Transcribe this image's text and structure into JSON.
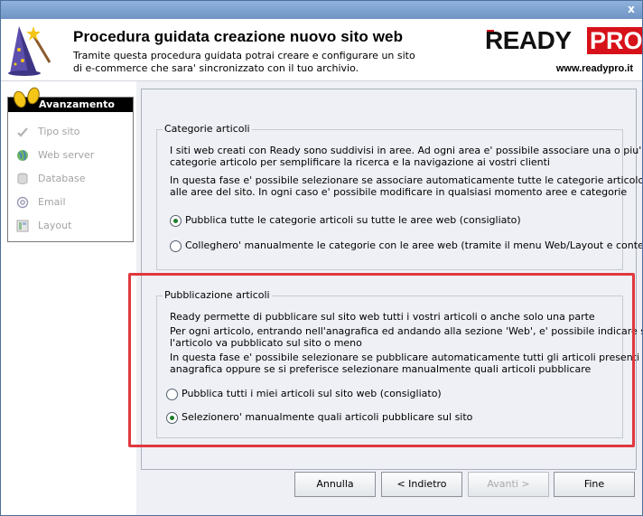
{
  "window": {
    "close_glyph": "x"
  },
  "header": {
    "title": "Procedura guidata creazione nuovo sito web",
    "description": "Tramite questa procedura guidata potrai creare e configurare un sito di e-commerce che sara' sincronizzato con il tuo archivio.",
    "logo": {
      "ready": "READY",
      "pro": "PRO",
      "brand_color": "#d7111a"
    },
    "url": "www.readypro.it"
  },
  "sidebar": {
    "title": "Avanzamento",
    "steps": [
      {
        "label": "Tipo sito",
        "icon": "checkmark-icon"
      },
      {
        "label": "Web server",
        "icon": "globe-icon"
      },
      {
        "label": "Database",
        "icon": "database-icon"
      },
      {
        "label": "Email",
        "icon": "at-sign-icon"
      },
      {
        "label": "Layout",
        "icon": "layout-icon"
      }
    ]
  },
  "categorie": {
    "legend": "Categorie articoli",
    "line1": "I siti web creati con Ready sono suddivisi in aree. Ad ogni area e' possibile associare una o piu'",
    "line2": "categorie articolo per semplificare la ricerca e la navigazione ai vostri clienti",
    "line3": "In questa fase e' possibile selezionare se associare automaticamente tutte le categorie articolo",
    "line4": "alle aree del sito. In ogni caso e' possibile modificare in qualsiasi momento aree e categorie",
    "option1": "Pubblica tutte le categorie articoli su tutte le aree web (consigliato)",
    "option2": "Colleghero' manualmente le categorie con le aree web (tramite il menu Web/Layout e contenuti)",
    "selected": 1
  },
  "pubblicazione": {
    "legend": "Pubblicazione articoli",
    "line1": "Ready permette di pubblicare sul sito web tutti i vostri articoli o anche solo una parte",
    "line2": "Per ogni articolo, entrando nell'anagrafica ed andando alla sezione 'Web', e' possibile indicare se",
    "line3": "l'articolo va pubblicato sul sito o meno",
    "line4": "In questa fase e' possibile selezionare se pubblicare automaticamente tutti gli articoli presenti in",
    "line5": "anagrafica oppure se si preferisce selezionare manualmente quali articoli pubblicare",
    "option1": "Pubblica tutti i miei articoli sul sito web (consigliato)",
    "option2": "Selezionero' manualmente quali articoli pubblicare sul sito",
    "selected": 2
  },
  "buttons": {
    "cancel": "Annulla",
    "back": "< Indietro",
    "next": "Avanti >",
    "finish": "Fine"
  },
  "highlight_color": "#e0383e"
}
